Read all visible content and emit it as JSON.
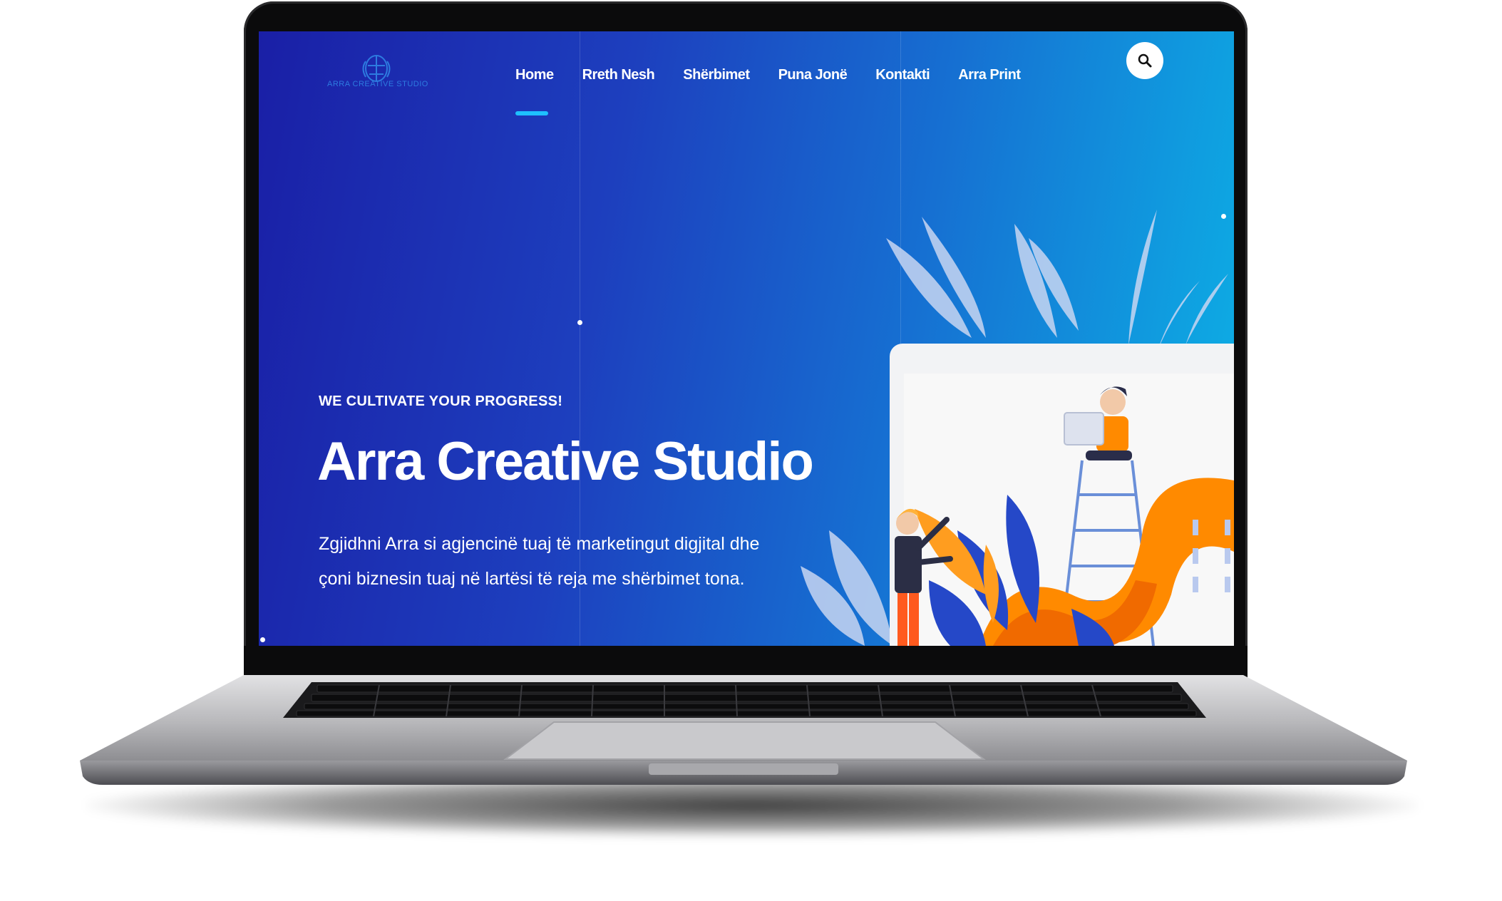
{
  "site": {
    "logo_text": "ARRA CREATIVE STUDIO",
    "nav": {
      "items": [
        {
          "label": "Home",
          "active": true
        },
        {
          "label": "Rreth Nesh"
        },
        {
          "label": "Shërbimet"
        },
        {
          "label": "Puna Jonë"
        },
        {
          "label": "Kontakti"
        },
        {
          "label": "Arra Print"
        }
      ],
      "search_icon": "search-icon"
    },
    "hero": {
      "tagline": "WE CULTIVATE YOUR PROGRESS!",
      "title": "Arra Creative Studio",
      "description": "Zgjidhni Arra si agjencinë tuaj të marketingut digjital dhe çoni biznesin tuaj në lartësi të reja me shërbimet tona."
    }
  },
  "colors": {
    "gradient_start": "#1a1fa6",
    "gradient_end": "#0cb3e6",
    "accent": "#1ec0ff",
    "orange": "#ff8a00",
    "leaf": "#c8d6f2"
  }
}
